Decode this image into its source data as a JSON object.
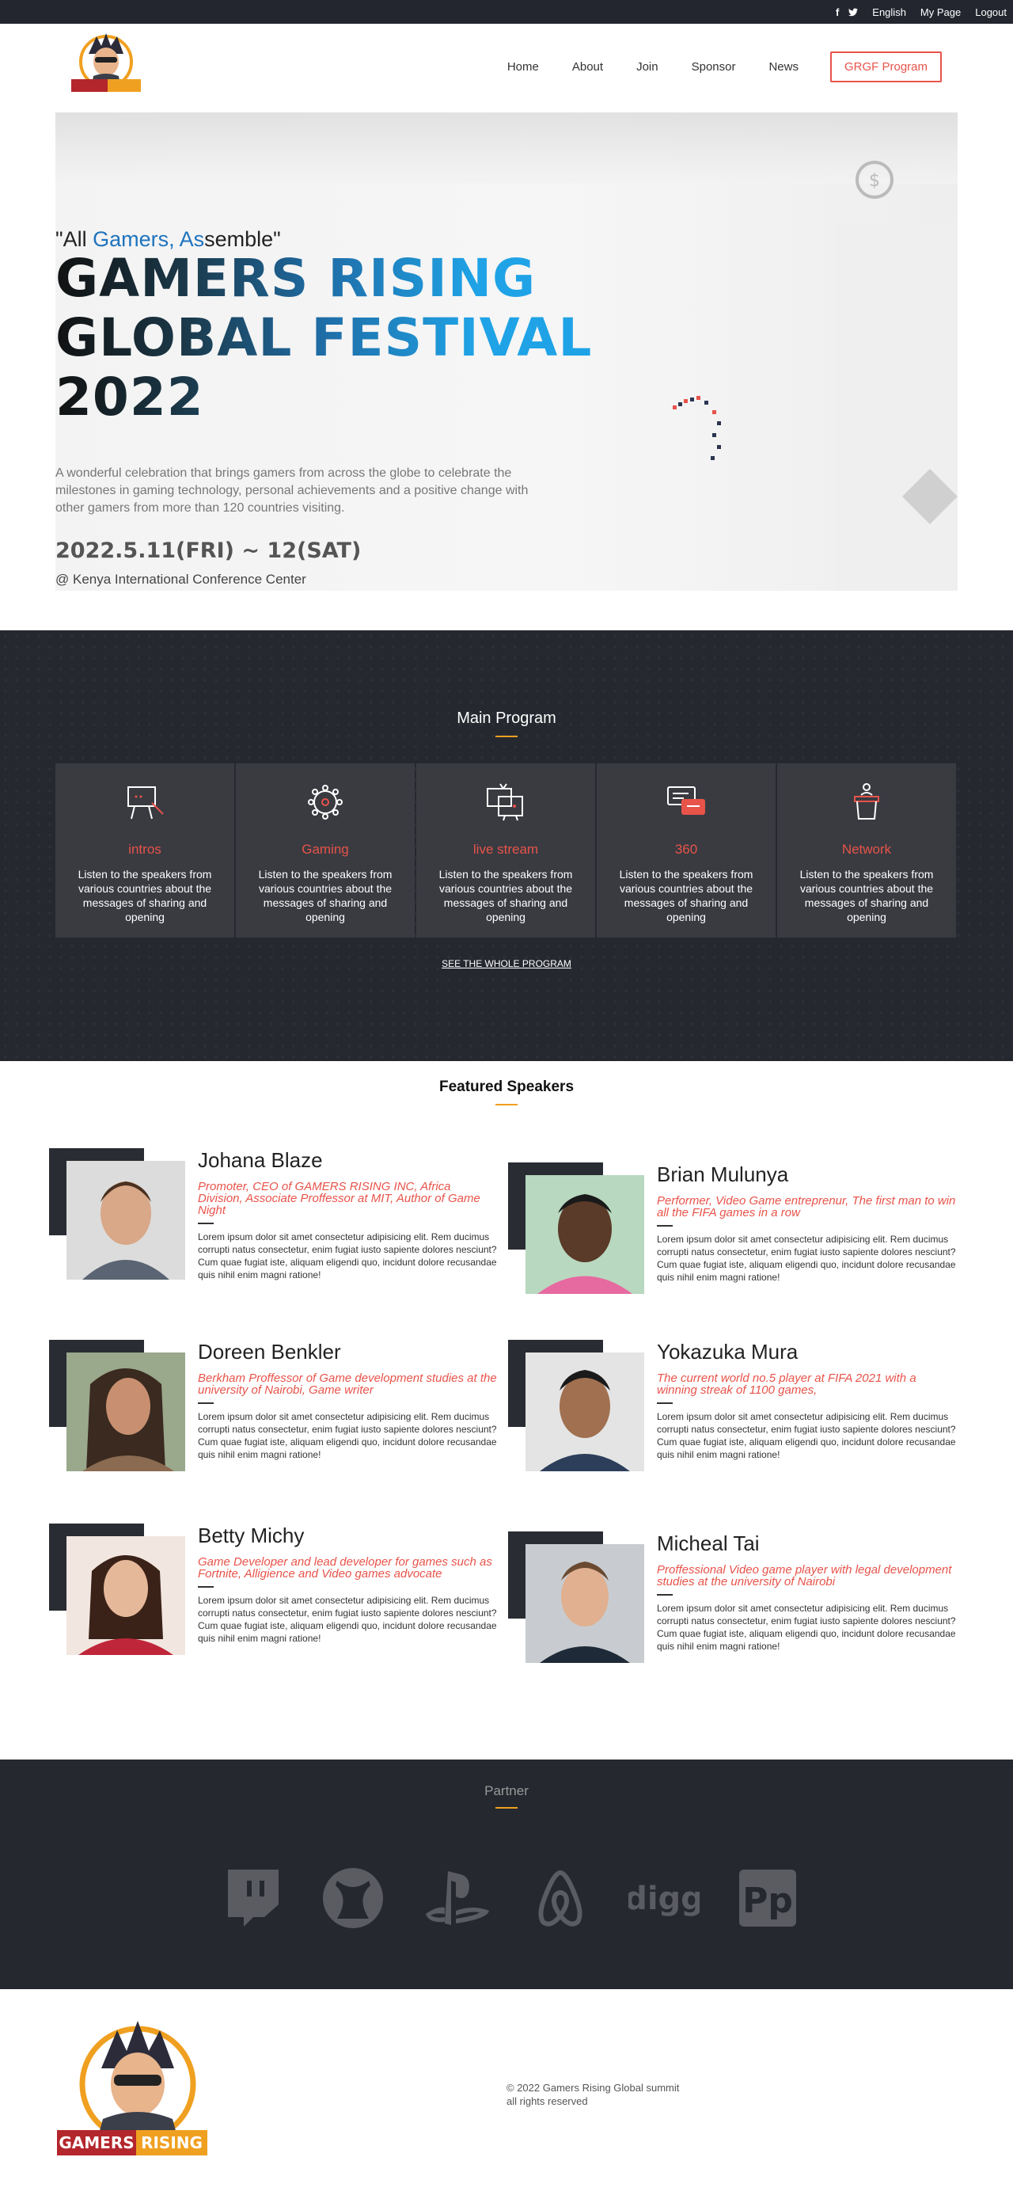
{
  "topbar": {
    "language": "English",
    "my_page": "My Page",
    "logout": "Logout"
  },
  "logo": {
    "text_left": "GAMERS",
    "text_right": "RISING"
  },
  "nav": {
    "items": [
      "Home",
      "About",
      "Join",
      "Sponsor",
      "News"
    ],
    "cta": "GRGF Program"
  },
  "hero": {
    "tagline_open": "\"All ",
    "tagline_highlight": "Gamers, As",
    "tagline_rest": "semble\"",
    "title_line1": "GAMERS RISING",
    "title_line2": "GLOBAL FESTIVAL",
    "title_line3": "2022",
    "description": "A wonderful celebration that brings gamers from across the globe to celebrate the milestones in gaming technology, personal achievements and a positive change with other gamers from more than 120 countries visiting.",
    "date": "2022.5.11(FRI) ~ 12(SAT)",
    "venue": "@ Kenya International Conference Center"
  },
  "program": {
    "title": "Main Program",
    "see_all": "SEE THE WHOLE PROGRAM",
    "cards": [
      {
        "icon": "presentation-icon",
        "title": "intros",
        "text": "Listen to the speakers from various countries about the messages of sharing and opening"
      },
      {
        "icon": "network-icon",
        "title": "Gaming",
        "text": "Listen to the speakers from various countries about the messages of sharing and opening"
      },
      {
        "icon": "screens-icon",
        "title": "live stream",
        "text": "Listen to the speakers from various countries about the messages of sharing and opening"
      },
      {
        "icon": "chat-icon",
        "title": "360",
        "text": "Listen to the speakers from various countries about the messages of sharing and opening"
      },
      {
        "icon": "podium-icon",
        "title": "Network",
        "text": "Listen to the speakers from various countries about the messages of sharing and opening"
      }
    ]
  },
  "speakers": {
    "title": "Featured Speakers",
    "bio": "Lorem ipsum dolor sit amet consectetur adipisicing elit. Rem ducimus corrupti natus consectetur, enim fugiat iusto sapiente dolores nesciunt? Cum quae fugiat iste, aliquam eligendi quo, incidunt dolore recusandae quis nihil enim magni ratione!",
    "list": [
      {
        "name": "Johana Blaze",
        "role": "Promoter, CEO of GAMERS RISING INC, Africa Division, Associate Proffessor at MIT, Author of Game Night"
      },
      {
        "name": "Brian Mulunya",
        "role": "Performer, Video Game entreprenur, The first man to win all the FIFA games in a row"
      },
      {
        "name": "Doreen Benkler",
        "role": "Berkham Proffessor of Game development studies at the university of Nairobi, Game writer"
      },
      {
        "name": "Yokazuka Mura",
        "role": "The current world no.5 player at FIFA 2021 with a winning streak of 1100 games,"
      },
      {
        "name": "Betty Michy",
        "role": "Game Developer and lead developer for games such as Fortnite, Alligience and Video games advocate"
      },
      {
        "name": "Micheal Tai",
        "role": "Proffessional Video game player with legal development studies at the university of Nairobi"
      }
    ]
  },
  "partners": {
    "title": "Partner",
    "logos": [
      "twitch-logo",
      "xbox-logo",
      "playstation-logo",
      "airbnb-logo",
      "digg-logo",
      "producthunt-logo"
    ]
  },
  "footer": {
    "copyright": "© 2022 Gamers Rising Global summit",
    "rights": "all rights reserved"
  },
  "colors": {
    "accent": "#e8534a",
    "dark": "#25282f",
    "gold": "#f0a020",
    "blue": "#1e73be"
  }
}
